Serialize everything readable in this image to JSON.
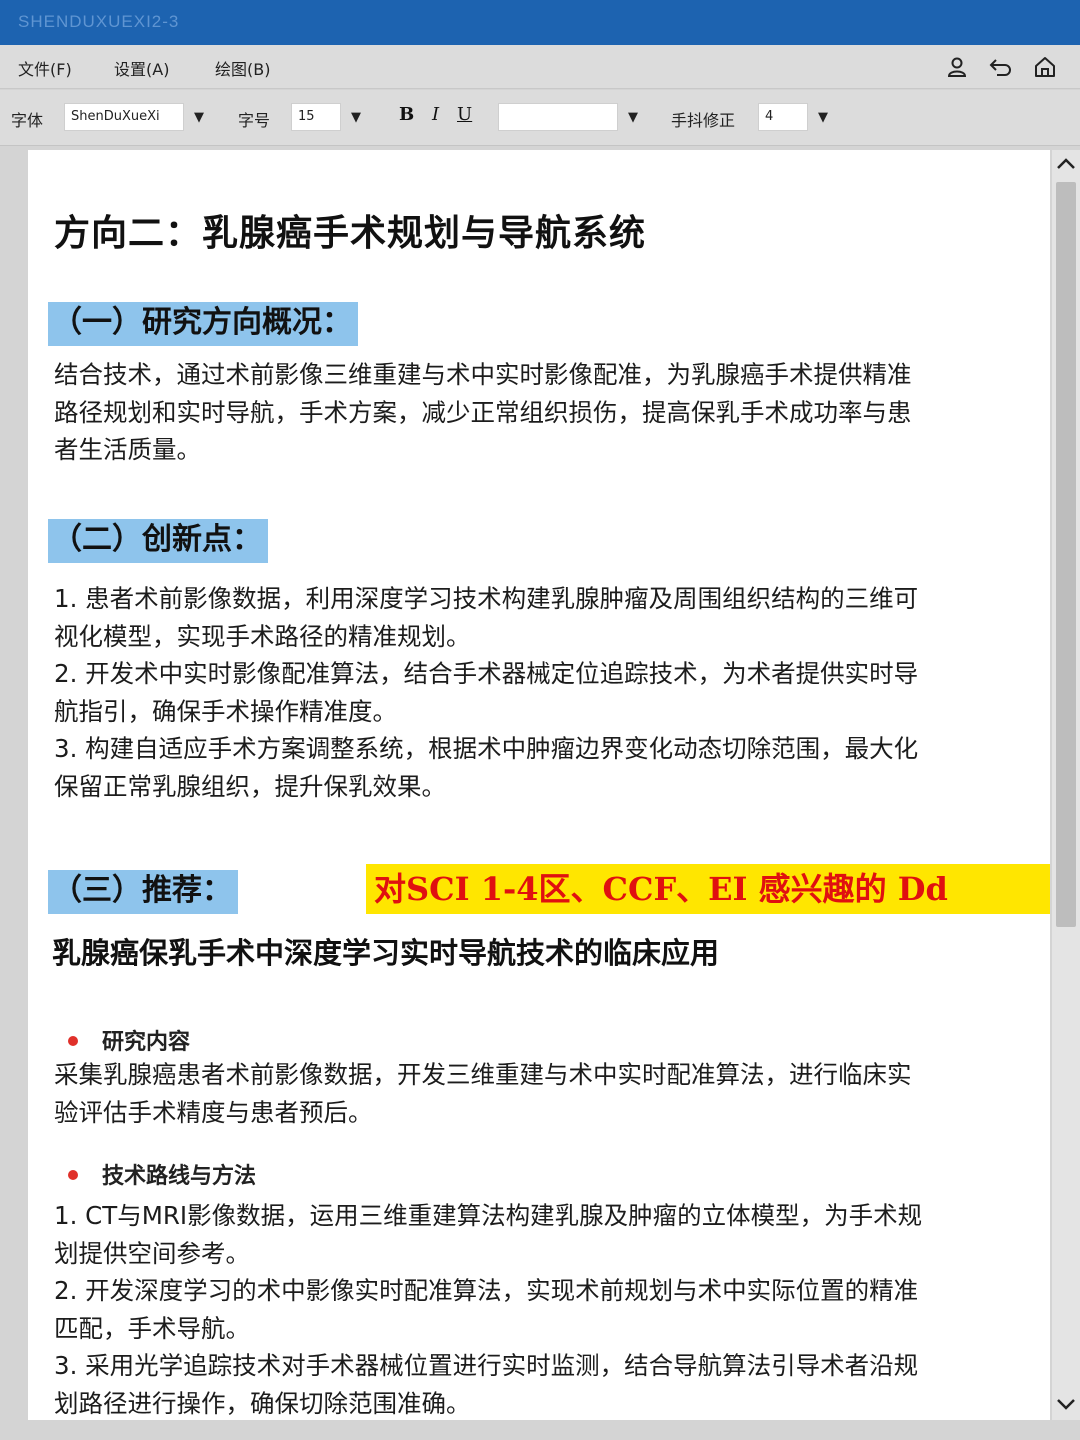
{
  "window": {
    "title": "SHENDUXUEXI2-3"
  },
  "menu": {
    "file": "文件(F)",
    "settings": "设置(A)",
    "draw": "绘图(B)"
  },
  "toolbar": {
    "font_label": "字体",
    "font_value": "ShenDuXueXi",
    "size_label": "字号",
    "size_value": "15",
    "bold": "B",
    "italic": "I",
    "underline": "U",
    "color_value": "",
    "shake_label": "手抖修正",
    "shake_value": "4"
  },
  "icons": {
    "user": "user-icon",
    "undo": "undo-icon",
    "home": "home-icon",
    "dropdown": "caret-down-icon",
    "scroll_up": "chevron-up-icon",
    "scroll_down": "chevron-down-icon"
  },
  "doc": {
    "title": "方向二：乳腺癌手术规划与导航系统",
    "s1_head": "（一）研究方向概况：",
    "s1_lines": [
      "结合技术，通过术前影像三维重建与术中实时影像配准，为乳腺癌手术提供精准",
      "路径规划和实时导航，手术方案，减少正常组织损伤，提高保乳手术成功率与患",
      "者生活质量。"
    ],
    "s2_head": "（二）创新点：",
    "s2_lines": [
      "1. 患者术前影像数据，利用深度学习技术构建乳腺肿瘤及周围组织结构的三维可",
      "视化模型，实现手术路径的精准规划。",
      "2. 开发术中实时影像配准算法，结合手术器械定位追踪技术，为术者提供实时导",
      "航指引，确保手术操作精准度。",
      "3. 构建自适应手术方案调整系统，根据术中肿瘤边界变化动态切除范围，最大化",
      "保留正常乳腺组织，提升保乳效果。"
    ],
    "s3_head": "（三）推荐：",
    "ad": "对SCI 1-4区、CCF、EI 感兴趣的 Dd",
    "sub_title": "乳腺癌保乳手术中深度学习实时导航技术的临床应用",
    "b1_label": "研究内容",
    "b1_lines": [
      "采集乳腺癌患者术前影像数据，开发三维重建与术中实时配准算法，进行临床实",
      "验评估手术精度与患者预后。"
    ],
    "b2_label": "技术路线与方法",
    "b2_lines": [
      "1. CT与MRI影像数据，运用三维重建算法构建乳腺及肿瘤的立体模型，为手术规",
      "划提供空间参考。",
      "2. 开发深度学习的术中影像实时配准算法，实现术前规划与术中实际位置的精准",
      "匹配，手术导航。",
      "3. 采用光学追踪技术对手术器械位置进行实时监测，结合导航算法引导术者沿规",
      "划路径进行操作，确保切除范围准确。"
    ]
  },
  "colors": {
    "titlebar": "#1d63b0",
    "section_highlight": "#8ec4ec",
    "ad_bg": "#ffe600",
    "ad_text": "#e01010",
    "bullet": "#e0302a"
  }
}
